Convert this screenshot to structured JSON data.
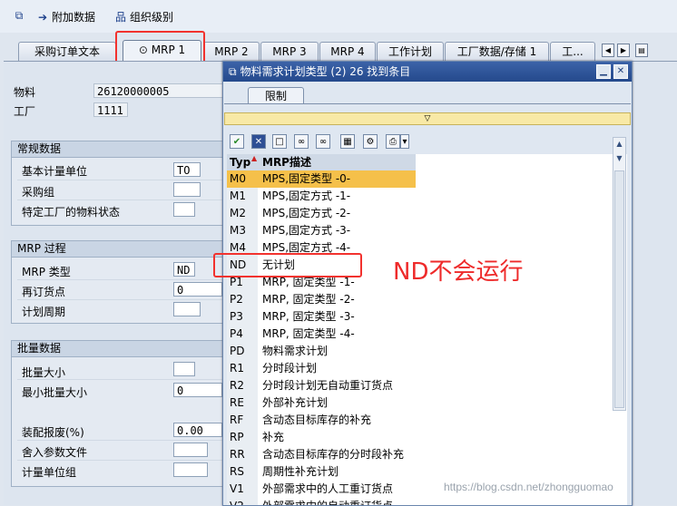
{
  "toolbar": {
    "add_data": "附加数据",
    "org_levels": "组织级别"
  },
  "tabs": [
    "采购订单文本",
    "MRP 1",
    "MRP 2",
    "MRP 3",
    "MRP 4",
    "工作计划",
    "工厂数据/存储 1",
    "工..."
  ],
  "header": {
    "material_label": "物料",
    "material_value": "26120000005",
    "plant_label": "工厂",
    "plant_value": "1111"
  },
  "general": {
    "title": "常规数据",
    "base_uom_label": "基本计量单位",
    "base_uom_value": "TO",
    "purch_group_label": "采购组",
    "plant_status_label": "特定工厂的物料状态"
  },
  "mrp_proc": {
    "title": "MRP 过程",
    "mrp_type_label": "MRP 类型",
    "mrp_type_value": "ND",
    "reorder_label": "再订货点",
    "reorder_value": "0",
    "planning_cycle_label": "计划周期"
  },
  "lot": {
    "title": "批量数据",
    "lot_size_label": "批量大小",
    "min_lot_label": "最小批量大小",
    "min_lot_value": "0",
    "assembly_scrap_label": "装配报废(%)",
    "assembly_scrap_value": "0.00",
    "rounding_profile_label": "舍入参数文件",
    "unit_group_label": "计量单位组"
  },
  "popup": {
    "title": "物料需求计划类型 (2)   26 找到条目",
    "restrict_tab": "限制",
    "col_type": "Typ",
    "col_desc": "MRP描述",
    "rows": [
      {
        "code": "M0",
        "desc": "MPS,固定类型 -0-"
      },
      {
        "code": "M1",
        "desc": "MPS,固定方式 -1-"
      },
      {
        "code": "M2",
        "desc": "MPS,固定方式 -2-"
      },
      {
        "code": "M3",
        "desc": "MPS,固定方式 -3-"
      },
      {
        "code": "M4",
        "desc": "MPS,固定方式 -4-"
      },
      {
        "code": "ND",
        "desc": "无计划"
      },
      {
        "code": "P1",
        "desc": "MRP, 固定类型 -1-"
      },
      {
        "code": "P2",
        "desc": "MRP, 固定类型 -2-"
      },
      {
        "code": "P3",
        "desc": "MRP, 固定类型 -3-"
      },
      {
        "code": "P4",
        "desc": "MRP, 固定类型 -4-"
      },
      {
        "code": "PD",
        "desc": "物料需求计划"
      },
      {
        "code": "R1",
        "desc": "分时段计划"
      },
      {
        "code": "R2",
        "desc": "分时段计划无自动重订货点"
      },
      {
        "code": "RE",
        "desc": "外部补充计划"
      },
      {
        "code": "RF",
        "desc": "含动态目标库存的补充"
      },
      {
        "code": "RP",
        "desc": "补充"
      },
      {
        "code": "RR",
        "desc": "含动态目标库存的分时段补充"
      },
      {
        "code": "RS",
        "desc": "周期性补充计划"
      },
      {
        "code": "V1",
        "desc": "外部需求中的人工重订货点"
      },
      {
        "code": "V2",
        "desc": "外部需求中的自动重订货点"
      }
    ]
  },
  "annotation": "ND不会运行",
  "watermark": "https://blog.csdn.net/zhongguomao",
  "colors": {
    "title_bar": "#2c5395",
    "selection": "#f5c04a",
    "annotation_red": "#ee2a2a"
  }
}
